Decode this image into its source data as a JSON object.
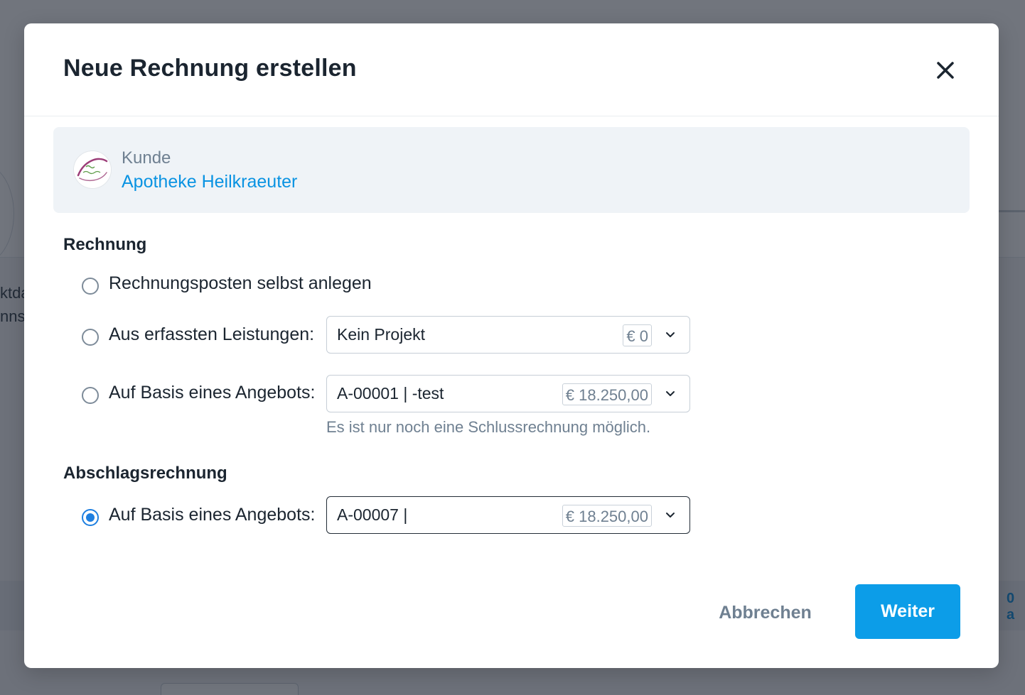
{
  "background": {
    "left_text_line1": "ktda",
    "left_text_line2": "nnst",
    "right_link": "0 a"
  },
  "modal": {
    "title": "Neue Rechnung erstellen",
    "customer": {
      "label": "Kunde",
      "name": "Apotheke Heilkraeuter"
    },
    "sections": {
      "rechnung": {
        "title": "Rechnung",
        "options": [
          {
            "label": "Rechnungsposten selbst anlegen",
            "checked": false
          },
          {
            "label": "Aus erfassten Leistungen:",
            "checked": false,
            "select_value": "Kein Projekt",
            "amount": "€ 0"
          },
          {
            "label": "Auf Basis eines Angebots:",
            "checked": false,
            "select_value": "A-00001 | -test",
            "amount": "€ 18.250,00",
            "hint": "Es ist nur noch eine Schlussrechnung möglich."
          }
        ]
      },
      "abschlag": {
        "title": "Abschlagsrechnung",
        "options": [
          {
            "label": "Auf Basis eines Angebots:",
            "checked": true,
            "select_value": "A-00007 |",
            "amount": "€ 18.250,00"
          }
        ]
      }
    },
    "buttons": {
      "cancel": "Abbrechen",
      "next": "Weiter"
    },
    "colors": {
      "accent": "#0c9de8",
      "radio_checked": "#1e7fe0",
      "link": "#0a93e2"
    },
    "icons": {
      "close": "close-icon",
      "chevron": "chevron-down-icon"
    }
  }
}
